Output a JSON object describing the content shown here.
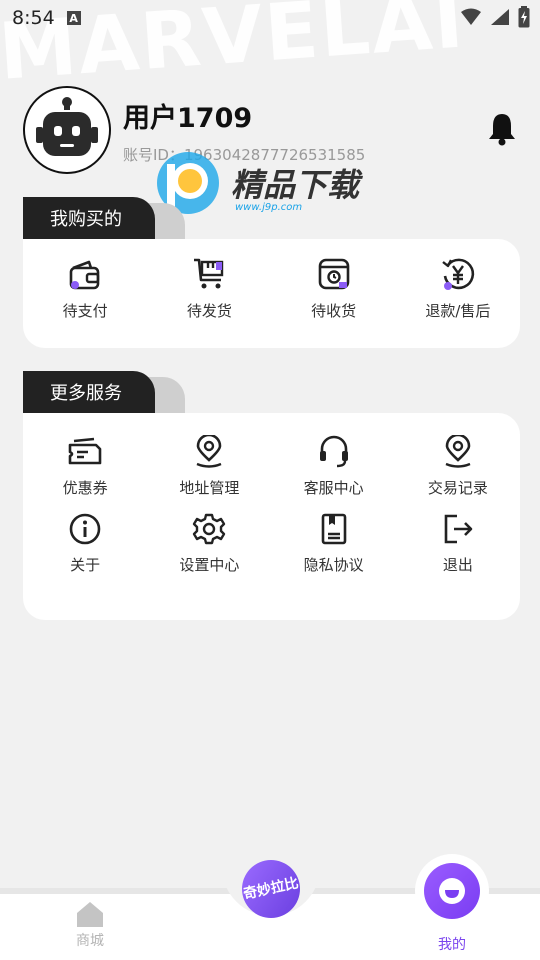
{
  "status_bar": {
    "time": "8:54",
    "notification_letter": "A"
  },
  "background_text": "MARVELAI",
  "profile": {
    "name": "用户1709",
    "account_id": "账号ID：1963042877726531585"
  },
  "watermark": {
    "title": "精品下载",
    "url": "www.j9p.com"
  },
  "purchases": {
    "title": "我购买的",
    "items": [
      {
        "label": "待支付",
        "icon": "wallet-icon"
      },
      {
        "label": "待发货",
        "icon": "cart-icon"
      },
      {
        "label": "待收货",
        "icon": "package-icon"
      },
      {
        "label": "退款/售后",
        "icon": "refund-yen-icon"
      }
    ]
  },
  "services": {
    "title": "更多服务",
    "items": [
      {
        "label": "优惠券",
        "icon": "coupon-icon"
      },
      {
        "label": "地址管理",
        "icon": "location-pin-icon"
      },
      {
        "label": "客服中心",
        "icon": "headset-icon"
      },
      {
        "label": "交易记录",
        "icon": "location-pin-icon"
      },
      {
        "label": "关于",
        "icon": "info-icon"
      },
      {
        "label": "设置中心",
        "icon": "gear-icon"
      },
      {
        "label": "隐私协议",
        "icon": "document-icon"
      },
      {
        "label": "退出",
        "icon": "logout-icon"
      }
    ]
  },
  "bottom_nav": {
    "home_label": "商城",
    "center_label": "奇妙拉比",
    "mine_label": "我的"
  },
  "colors": {
    "accent": "#7b45ee",
    "dark": "#222222",
    "indicator": "#8b5cf6"
  }
}
